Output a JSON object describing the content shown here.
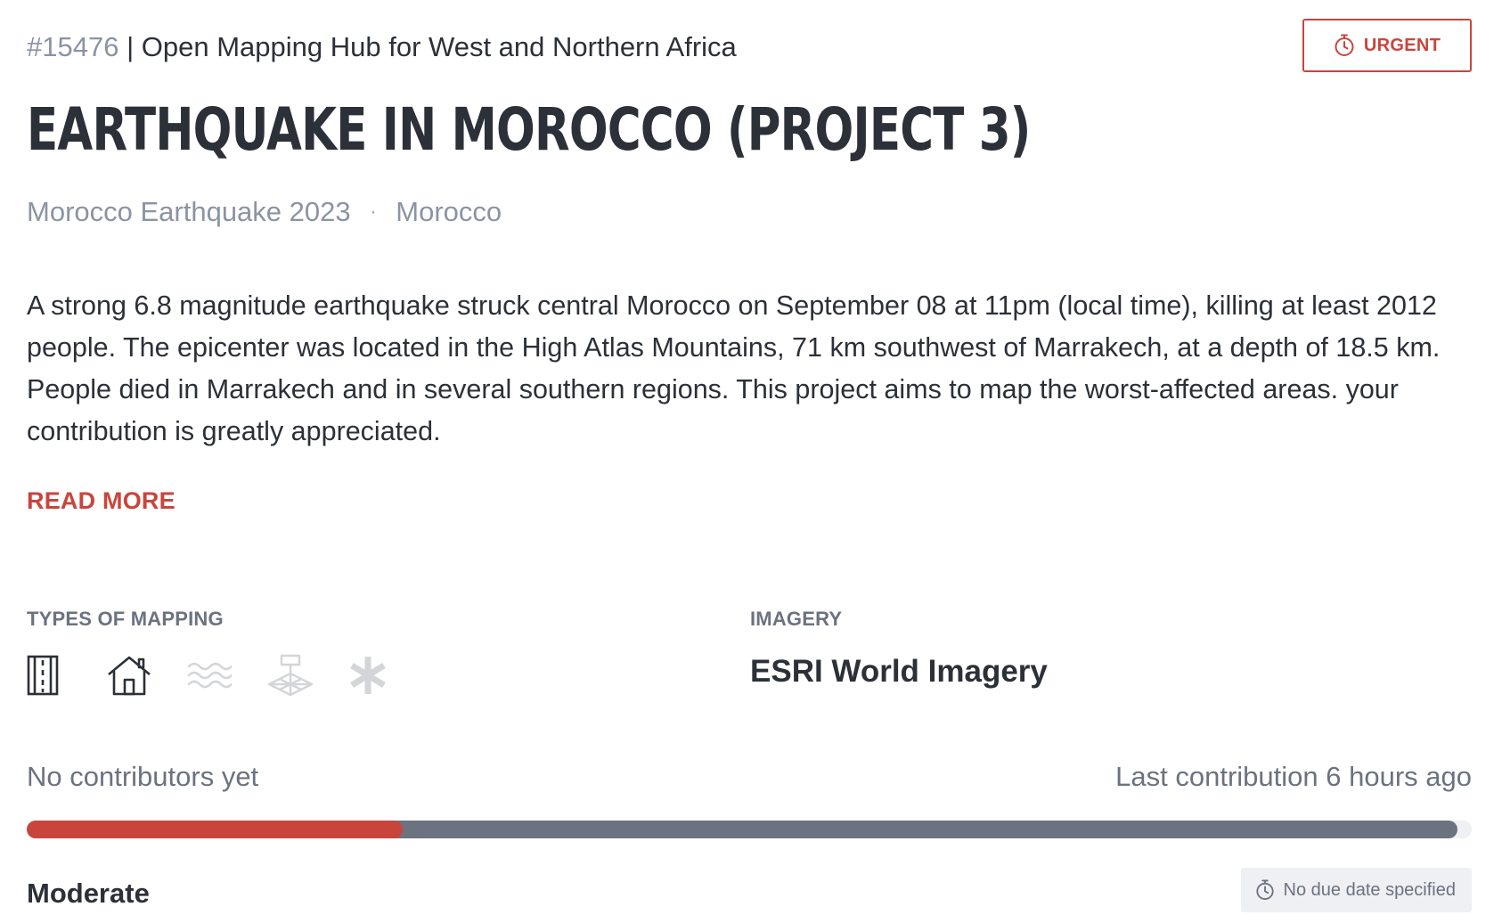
{
  "header": {
    "project_id": "#15476",
    "separator": "|",
    "organisation": "Open Mapping Hub for West and Northern Africa",
    "priority_label": "URGENT",
    "priority_icon": "timer-icon"
  },
  "project": {
    "title": "EARTHQUAKE IN MOROCCO (PROJECT 3)",
    "campaign": "Morocco Earthquake 2023",
    "subtitle_dot": "·",
    "country": "Morocco",
    "description": "A strong 6.8 magnitude earthquake struck central Morocco on September 08 at 11pm (local time), killing at least 2012 people. The epicenter was located in the High Atlas Mountains, 71 km southwest of Marrakech, at a depth of 18.5 km. People died in Marrakech and in several southern regions. This project aims to map the worst-affected areas. your contribution is greatly appreciated.",
    "read_more_label": "READ MORE"
  },
  "mapping": {
    "label": "TYPES OF MAPPING",
    "types": [
      {
        "name": "roads",
        "icon": "road-icon",
        "active": true
      },
      {
        "name": "buildings",
        "icon": "house-icon",
        "active": true
      },
      {
        "name": "waterways",
        "icon": "waves-icon",
        "active": false
      },
      {
        "name": "land use",
        "icon": "land-use-icon",
        "active": false
      },
      {
        "name": "other",
        "icon": "asterisk-icon",
        "active": false
      }
    ]
  },
  "imagery": {
    "label": "IMAGERY",
    "value": "ESRI World Imagery"
  },
  "stats": {
    "contributors": "No contributors yet",
    "last_contribution": "Last contribution 6 hours ago",
    "progress": {
      "mapped_percent": 26,
      "validated_percent": 99
    }
  },
  "footer": {
    "difficulty": "Moderate",
    "due_date": "No due date specified",
    "due_date_icon": "timer-icon"
  },
  "colors": {
    "accent": "#c9453c",
    "text": "#2c3038",
    "muted": "#8b93a4",
    "secondary": "#6b7280",
    "inactive_icon": "#d3d5d9"
  }
}
